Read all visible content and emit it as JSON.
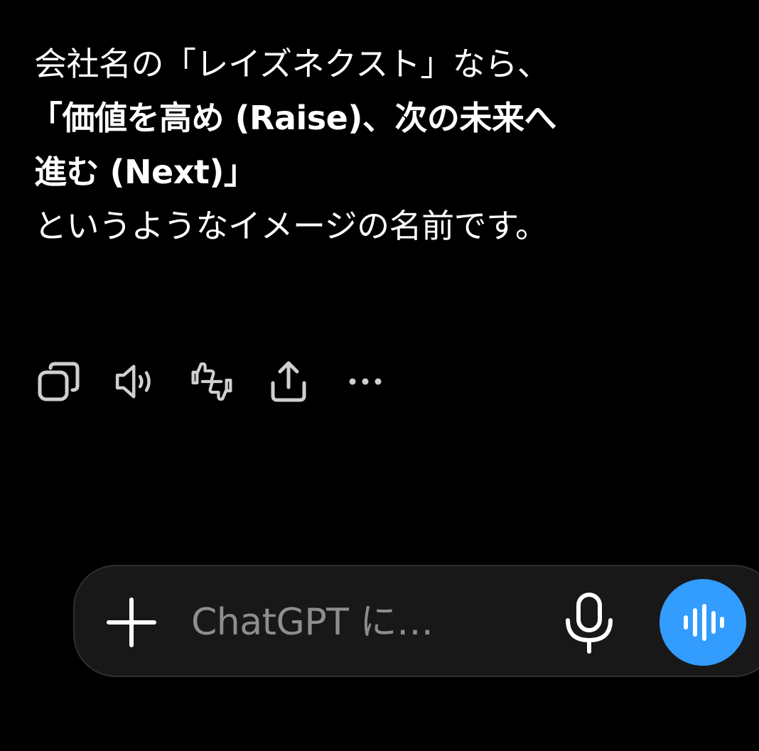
{
  "message": {
    "lines": [
      "会社名の「レイズネクスト」なら、",
      "「価値を高め (Raise)、次の未来へ",
      "進む (Next)」",
      "というようなイメージの名前です。"
    ]
  },
  "actions": {
    "icons": [
      "copy-icon",
      "read-aloud-icon",
      "feedback-icon",
      "share-icon",
      "more-icon"
    ]
  },
  "composer": {
    "placeholder": "ChatGPT に…",
    "plus_icon": "plus-icon",
    "mic_icon": "microphone-icon",
    "voice_icon": "voice-mode-icon",
    "voice_color": "#339cff"
  },
  "colors": {
    "background": "#000000",
    "text": "#ffffff",
    "icon": "#cfcfcf",
    "composer_bg": "#181818",
    "placeholder": "#8e8e8e"
  }
}
